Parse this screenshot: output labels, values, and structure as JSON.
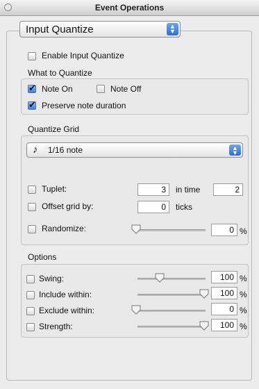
{
  "window": {
    "title": "Event Operations"
  },
  "operation_popup": {
    "value": "Input Quantize"
  },
  "enable": {
    "label": "Enable Input Quantize",
    "checked": false
  },
  "what_to_quantize": {
    "heading": "What to Quantize",
    "note_on": {
      "label": "Note On",
      "checked": true
    },
    "note_off": {
      "label": "Note Off",
      "checked": false
    },
    "preserve": {
      "label": "Preserve note duration",
      "checked": true
    }
  },
  "grid": {
    "heading": "Quantize Grid",
    "note_value": "1/16 note",
    "note_glyph": "♪",
    "tuplet": {
      "label": "Tuplet:",
      "value": "3",
      "in_time_label": "in time",
      "in_time_value": "2",
      "checked": false
    },
    "offset": {
      "label": "Offset grid by:",
      "value": "0",
      "unit": "ticks",
      "checked": false
    },
    "randomize": {
      "label": "Randomize:",
      "value": "0",
      "unit": "%",
      "checked": false,
      "level": 0.0
    }
  },
  "options": {
    "heading": "Options",
    "swing": {
      "label": "Swing:",
      "value": "100",
      "unit": "%",
      "checked": false,
      "level": 0.35
    },
    "include": {
      "label": "Include within:",
      "value": "100",
      "unit": "%",
      "checked": false,
      "level": 1.0
    },
    "exclude": {
      "label": "Exclude within:",
      "value": "0",
      "unit": "%",
      "checked": false,
      "level": 0.0
    },
    "strength": {
      "label": "Strength:",
      "value": "100",
      "unit": "%",
      "checked": false,
      "level": 1.0
    }
  }
}
